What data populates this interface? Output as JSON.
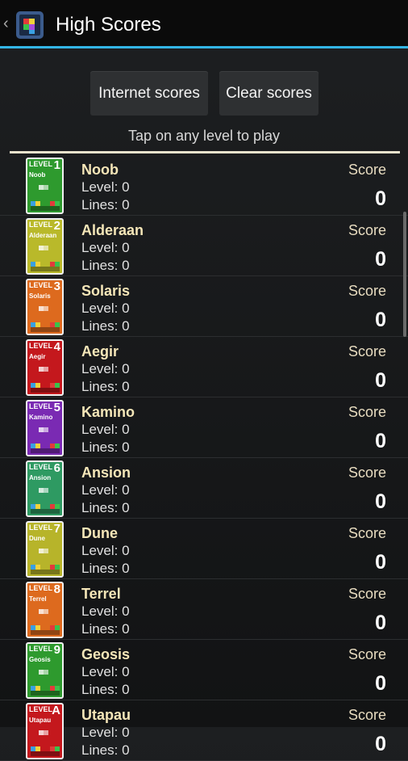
{
  "actionbar": {
    "title": "High Scores",
    "back_icon": "chevron-left-icon",
    "app_icon": "tetris-blocks-icon"
  },
  "buttons": {
    "internet": "Internet scores",
    "clear": "Clear scores"
  },
  "hint": "Tap on any level to play",
  "labels": {
    "score": "Score",
    "level_prefix": "Level: ",
    "lines_prefix": "Lines: "
  },
  "levels": [
    {
      "tile_level": "LEVEL",
      "tile_number": "1",
      "tile_name": "Noob",
      "name": "Noob",
      "level": "Level: 0",
      "lines": "Lines: 0",
      "score_label": "Score",
      "score": "0",
      "color": "#2e9a2e"
    },
    {
      "tile_level": "LEVEL",
      "tile_number": "2",
      "tile_name": "Alderaan",
      "name": "Alderaan",
      "level": "Level: 0",
      "lines": "Lines: 0",
      "score_label": "Score",
      "score": "0",
      "color": "#b9b92a"
    },
    {
      "tile_level": "LEVEL",
      "tile_number": "3",
      "tile_name": "Solaris",
      "name": "Solaris",
      "level": "Level: 0",
      "lines": "Lines: 0",
      "score_label": "Score",
      "score": "0",
      "color": "#dd6a1e"
    },
    {
      "tile_level": "LEVEL",
      "tile_number": "4",
      "tile_name": "Aegir",
      "name": "Aegir",
      "level": "Level: 0",
      "lines": "Lines: 0",
      "score_label": "Score",
      "score": "0",
      "color": "#c4181d"
    },
    {
      "tile_level": "LEVEL",
      "tile_number": "5",
      "tile_name": "Kamino",
      "name": "Kamino",
      "level": "Level: 0",
      "lines": "Lines: 0",
      "score_label": "Score",
      "score": "0",
      "color": "#7a2ab3"
    },
    {
      "tile_level": "LEVEL",
      "tile_number": "6",
      "tile_name": "Ansion",
      "name": "Ansion",
      "level": "Level: 0",
      "lines": "Lines: 0",
      "score_label": "Score",
      "score": "0",
      "color": "#2e9a62"
    },
    {
      "tile_level": "LEVEL",
      "tile_number": "7",
      "tile_name": "Dune",
      "name": "Dune",
      "level": "Level: 0",
      "lines": "Lines: 0",
      "score_label": "Score",
      "score": "0",
      "color": "#b7b42a"
    },
    {
      "tile_level": "LEVEL",
      "tile_number": "8",
      "tile_name": "Terrel",
      "name": "Terrel",
      "level": "Level: 0",
      "lines": "Lines: 0",
      "score_label": "Score",
      "score": "0",
      "color": "#dd6a1e"
    },
    {
      "tile_level": "LEVEL",
      "tile_number": "9",
      "tile_name": "Geosis",
      "name": "Geosis",
      "level": "Level: 0",
      "lines": "Lines: 0",
      "score_label": "Score",
      "score": "0",
      "color": "#2e9a2e"
    },
    {
      "tile_level": "LEVEL",
      "tile_number": "A",
      "tile_name": "Utapau",
      "name": "Utapau",
      "level": "Level: 0",
      "lines": "Lines: 0",
      "score_label": "Score",
      "score": "0",
      "color": "#c4181d"
    }
  ],
  "colors": {
    "accent": "#33b5e5",
    "name_text": "#f5e6b8",
    "divider": "#e8e2cc"
  }
}
